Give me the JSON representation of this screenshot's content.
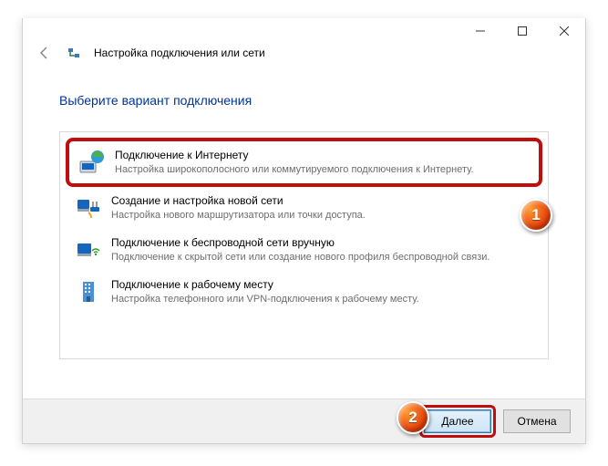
{
  "window": {
    "title": "Настройка подключения или сети"
  },
  "heading": "Выберите вариант подключения",
  "options": [
    {
      "title": "Подключение к Интернету",
      "desc": "Настройка широкополосного или коммутируемого подключения к Интернету."
    },
    {
      "title": "Создание и настройка новой сети",
      "desc": "Настройка нового маршрутизатора или точки доступа."
    },
    {
      "title": "Подключение к беспроводной сети вручную",
      "desc": "Подключение к скрытой сети или создание нового профиля беспроводной связи."
    },
    {
      "title": "Подключение к рабочему месту",
      "desc": "Настройка телефонного или VPN-подключения к рабочему месту."
    }
  ],
  "buttons": {
    "next": "Далее",
    "cancel": "Отмена"
  },
  "callouts": {
    "one": "1",
    "two": "2"
  }
}
